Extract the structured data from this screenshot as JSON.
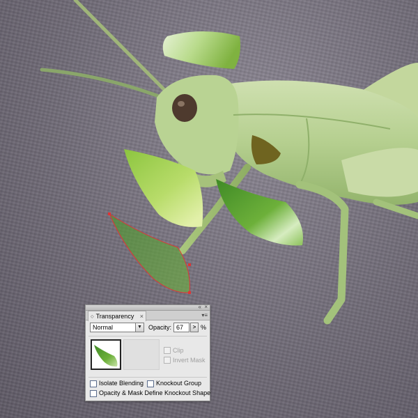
{
  "panel": {
    "tab_label": "Transparency",
    "tab_arrows_icon": "◇",
    "tab_close_icon": "×",
    "collapse_icon": "«",
    "close_icon": "×",
    "menu_icon": "▾≡",
    "blend_mode": "Normal",
    "blend_arrow_icon": "▼",
    "opacity_label": "Opacity:",
    "opacity_value": "67",
    "opacity_stepper_icon": ">",
    "opacity_unit": "%",
    "clip_label": "Clip",
    "invert_mask_label": "Invert Mask",
    "isolate_blending_label": "Isolate Blending",
    "knockout_group_label": "Knockout Group",
    "opacity_mask_label": "Opacity & Mask Define Knockout Shape",
    "checkboxes": {
      "clip": false,
      "invert_mask": false,
      "isolate_blending": false,
      "knockout_group": false,
      "opacity_mask": false
    }
  },
  "colors": {
    "leaf_light": "#dbeec4",
    "leaf_mid": "#9ccb55",
    "leaf_dark": "#5d9a26",
    "selected_leaf": "#3f8a2a",
    "selection_outline": "#e03434",
    "eye_hole": "#6f6420",
    "grasshopper_body": "#b7d093"
  },
  "artwork_icons": [
    "grasshopper-image",
    "leaf-shape"
  ]
}
